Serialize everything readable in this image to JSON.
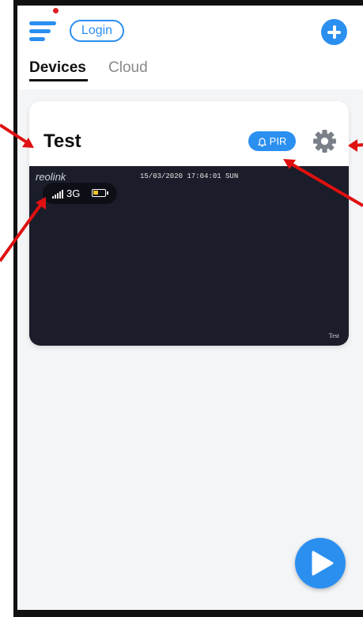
{
  "header": {
    "login_label": "Login",
    "icons": {
      "menu": "menu-icon",
      "add": "plus-circle-icon"
    }
  },
  "tabs": [
    {
      "label": "Devices",
      "active": true
    },
    {
      "label": "Cloud",
      "active": false
    }
  ],
  "device_card": {
    "name": "Test",
    "mode_badge": "PIR",
    "settings_icon": "gear-icon",
    "preview": {
      "brand": "reolink",
      "timestamp": "15/03/2020 17:04:01 SUN",
      "network": "3G",
      "camera_label": "Test"
    }
  },
  "fab": {
    "icon": "play-icon"
  },
  "colors": {
    "accent": "#2b8ff0",
    "background": "#f4f5f7",
    "preview_bg": "#1b1d2a",
    "annotation_arrow": "#e01010"
  }
}
